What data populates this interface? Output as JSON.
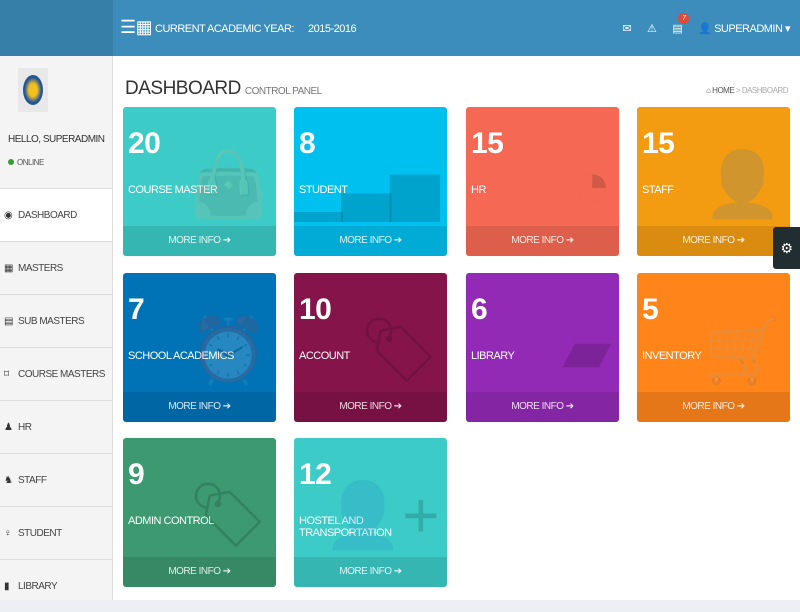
{
  "header": {
    "year_label": "CURRENT ACADEMIC YEAR:",
    "year_value": "2015-2016",
    "notification_count": "7",
    "user": "SUPERADMIN"
  },
  "sidebar": {
    "greeting": "HELLO, SUPERADMIN",
    "status": "ONLINE",
    "items": [
      {
        "label": "DASHBOARD",
        "icon": "dashboard-icon"
      },
      {
        "label": "MASTERS",
        "icon": "grid-icon"
      },
      {
        "label": "SUB MASTERS",
        "icon": "table-icon"
      },
      {
        "label": "COURSE MASTERS",
        "icon": "bookmark-icon"
      },
      {
        "label": "HR",
        "icon": "user-icon"
      },
      {
        "label": "STAFF",
        "icon": "users-icon"
      },
      {
        "label": "STUDENT",
        "icon": "male-icon"
      },
      {
        "label": "LIBRARY",
        "icon": "book-icon"
      }
    ]
  },
  "page": {
    "title": "DASHBOARD",
    "subtitle": "CONTROL PANEL",
    "breadcrumb_home": "HOME",
    "breadcrumb_current": "DASHBOARD"
  },
  "boxes": [
    {
      "value": "20",
      "label": "COURSE MASTER",
      "color": "#3ccbc7",
      "more": "MORE INFO"
    },
    {
      "value": "8",
      "label": "STUDENT",
      "color": "#00c0ef",
      "more": "MORE INFO"
    },
    {
      "value": "15",
      "label": "HR",
      "color": "#f56954",
      "more": "MORE INFO"
    },
    {
      "value": "15",
      "label": "STAFF",
      "color": "#f39c12",
      "more": "MORE INFO"
    },
    {
      "value": "7",
      "label": "SCHOOL ACADEMICS",
      "color": "#0073b7",
      "more": "MORE INFO"
    },
    {
      "value": "10",
      "label": "ACCOUNT",
      "color": "#85144b",
      "more": "MORE INFO"
    },
    {
      "value": "6",
      "label": "LIBRARY",
      "color": "#932ab6",
      "more": "MORE INFO"
    },
    {
      "value": "5",
      "label": "INVENTORY",
      "color": "#ff851b",
      "more": "MORE INFO"
    },
    {
      "value": "9",
      "label": "ADMIN CONTROL",
      "color": "#3d9970",
      "more": "MORE INFO"
    },
    {
      "value": "12",
      "label": "HOSTEL AND TRANSPORTATION",
      "color": "#3ccbc7",
      "more": "MORE INFO"
    }
  ]
}
